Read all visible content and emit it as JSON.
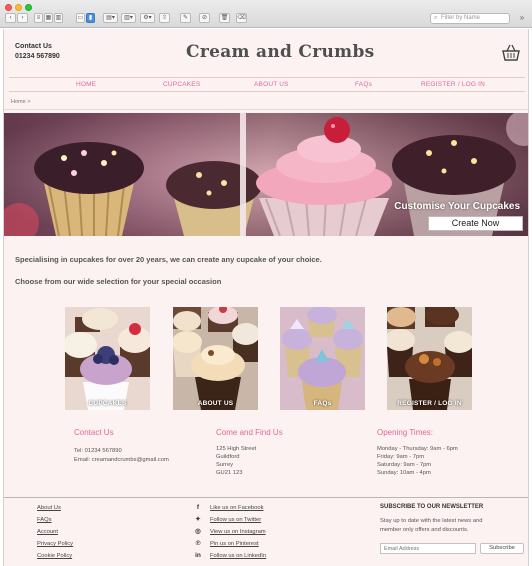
{
  "browser": {
    "search_placeholder": "Filter by Name",
    "toolbar_icons": [
      "back-icon",
      "forward-icon",
      "list-view-icon",
      "icon-view-icon",
      "column-view-icon",
      "gallery-view-icon",
      "group-icon",
      "arrange-icon",
      "action-gear-icon",
      "share-icon",
      "edit-tags-icon",
      "block-icon",
      "trash-icon",
      "tag-icon"
    ]
  },
  "header": {
    "contact_label": "Contact Us",
    "contact_phone": "01234 567890",
    "brand": "Cream and Crumbs",
    "basket_icon": "shopping-basket-icon"
  },
  "nav": [
    "HOME",
    "CUPCAKES",
    "ABOUT US",
    "FAQs",
    "REGISTER / LOG IN"
  ],
  "breadcrumb": "Home >",
  "hero": {
    "caption": "Customise Your Cupcakes",
    "button": "Create Now"
  },
  "intro": {
    "line1": "Specialising in cupcakes for over 20 years, we can create any cupcake of your choice.",
    "line2": "Choose from our wide selection for your special occasion"
  },
  "tiles": [
    "CUPCAKES",
    "ABOUT US",
    "FAQs",
    "REGISTER / LOG IN"
  ],
  "contact": {
    "title": "Contact Us",
    "tel": "Tel: 01234 567890",
    "email": "Email: creamandcrumbs@gmail.com"
  },
  "find": {
    "title": "Come and Find Us",
    "lines": [
      "125 High Street",
      "Guildford",
      "Surrey",
      "GU21 123"
    ]
  },
  "hours": {
    "title": "Opening Times:",
    "lines": [
      "Monday - Thursday: 9am - 6pm",
      "Friday: 9am - 7pm",
      "Saturday: 9am - 7pm",
      "Sunday: 10am - 4pm"
    ]
  },
  "footer": {
    "links": [
      "About Us",
      "FAQs",
      "Account",
      "Privacy Policy",
      "Cookie Policy"
    ],
    "social": [
      {
        "icon": "facebook-icon",
        "glyph": "f",
        "label": "Like us on Facebook"
      },
      {
        "icon": "twitter-icon",
        "glyph": "🐦",
        "label": "Follow us on Twitter"
      },
      {
        "icon": "instagram-icon",
        "glyph": "◎",
        "label": "View us on Instagram"
      },
      {
        "icon": "pinterest-icon",
        "glyph": "℗",
        "label": "Pin us on Pinterest"
      },
      {
        "icon": "linkedin-icon",
        "glyph": "in",
        "label": "Follow us on LinkedIn"
      }
    ],
    "newsletter": {
      "title": "SUBSCRIBE TO OUR NEWSLETTER",
      "line1": "Stay up to date with the latest news and",
      "line2": "member only offers and discounts.",
      "placeholder": "Email Address",
      "button": "Subscribe"
    }
  },
  "colors": {
    "accent_pink": "#e0679a",
    "page_bg": "#fdf2f2"
  }
}
